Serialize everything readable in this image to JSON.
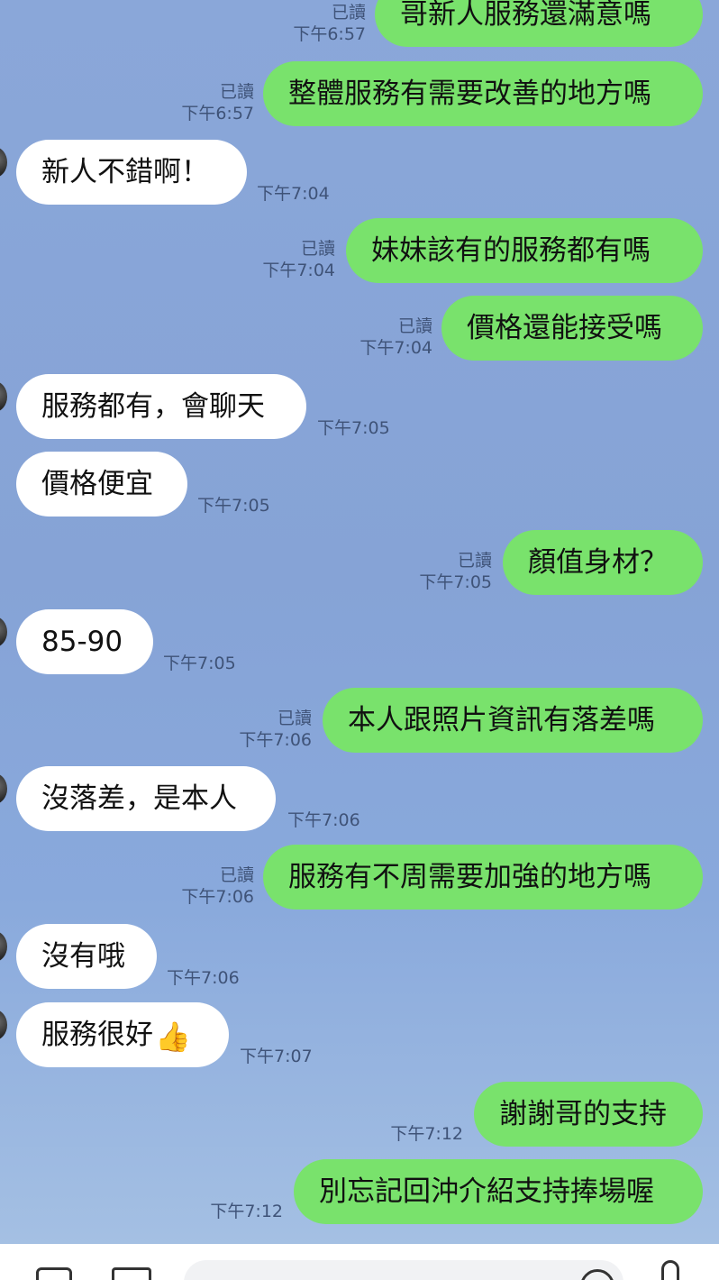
{
  "chat": {
    "messages": [
      {
        "side": "sent",
        "text": "哥新人服務還滿意嗎",
        "read": "已讀",
        "time": "下午6:57"
      },
      {
        "side": "sent",
        "text": "整體服務有需要改善的地方嗎",
        "read": "已讀",
        "time": "下午6:57"
      },
      {
        "side": "recv",
        "text": "新人不錯啊！",
        "time": "下午7:04"
      },
      {
        "side": "sent",
        "text": "妹妹該有的服務都有嗎",
        "read": "已讀",
        "time": "下午7:04"
      },
      {
        "side": "sent",
        "text": "價格還能接受嗎",
        "read": "已讀",
        "time": "下午7:04"
      },
      {
        "side": "recv",
        "text": "服務都有，會聊天",
        "time": "下午7:05"
      },
      {
        "side": "recv",
        "text": "價格便宜",
        "time": "下午7:05"
      },
      {
        "side": "sent",
        "text": "顏值身材？",
        "read": "已讀",
        "time": "下午7:05"
      },
      {
        "side": "recv",
        "text": "85-90",
        "time": "下午7:05"
      },
      {
        "side": "sent",
        "text": "本人跟照片資訊有落差嗎",
        "read": "已讀",
        "time": "下午7:06"
      },
      {
        "side": "recv",
        "text": "沒落差，是本人",
        "time": "下午7:06"
      },
      {
        "side": "sent",
        "text": "服務有不周需要加強的地方嗎",
        "read": "已讀",
        "time": "下午7:06"
      },
      {
        "side": "recv",
        "text": "沒有哦",
        "time": "下午7:06"
      },
      {
        "side": "recv",
        "text": "服務很好",
        "emoji": "👍",
        "time": "下午7:07"
      },
      {
        "side": "sent",
        "text": "謝謝哥的支持",
        "time": "下午7:12"
      },
      {
        "side": "sent",
        "text": "別忘記回沖介紹支持捧場喔",
        "time": "下午7:12"
      }
    ]
  },
  "input_bar": {
    "icons": [
      "camera-icon",
      "image-icon",
      "emoji-icon",
      "microphone-icon"
    ]
  },
  "colors": {
    "sent_bubble": "#79e26c",
    "received_bubble": "#ffffff",
    "background": "#8aa7d9"
  }
}
